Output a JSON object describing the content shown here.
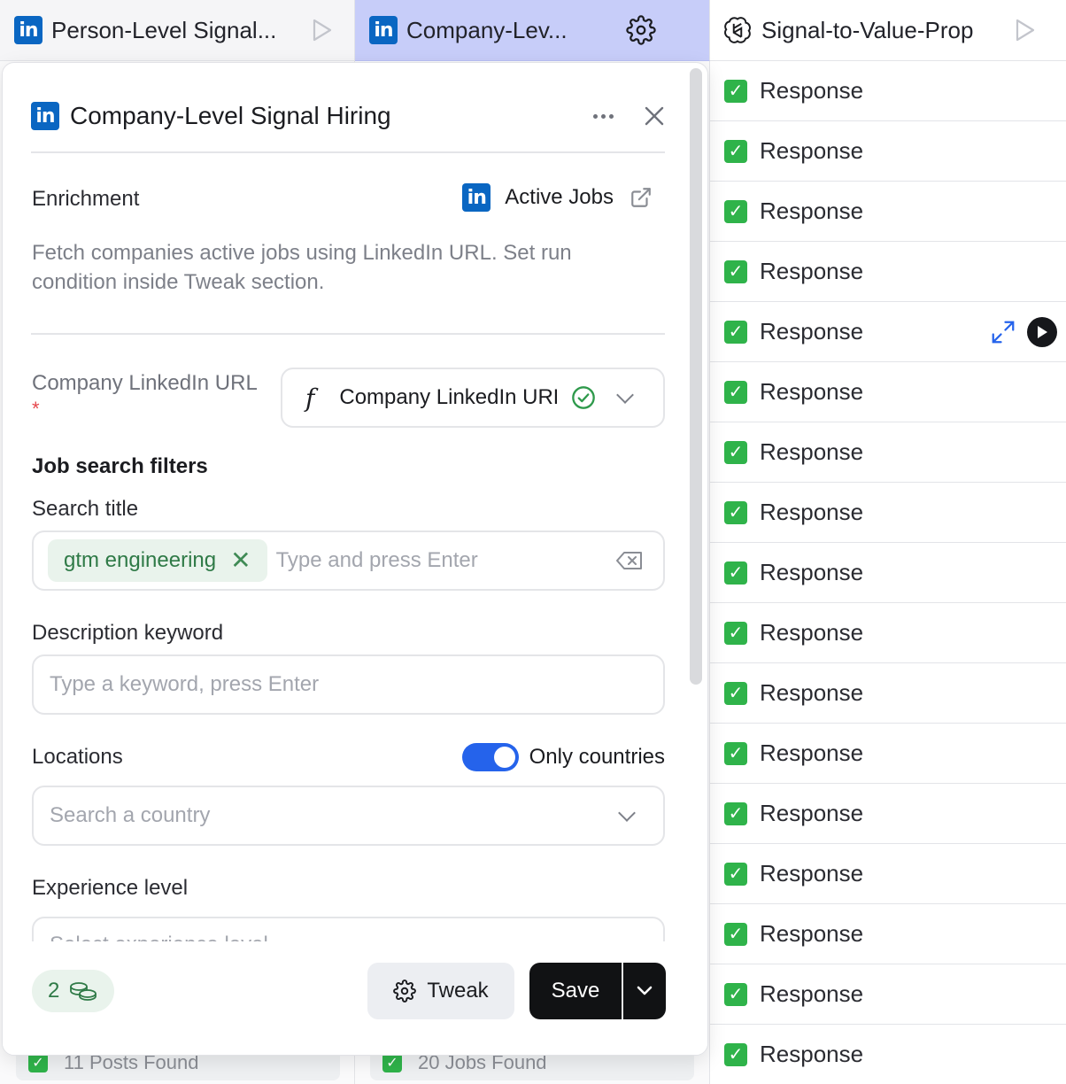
{
  "columns": [
    {
      "label": "Person-Level Signal...",
      "icon": "linkedin-icon"
    },
    {
      "label": "Company-Lev...",
      "icon": "linkedin-icon"
    },
    {
      "label": "Signal-to-Value-Prop",
      "icon": "openai-icon"
    }
  ],
  "linkedin_glyph": "in",
  "panel": {
    "title": "Company-Level Signal Hiring",
    "enrichment_label": "Enrichment",
    "enrichment_source": "Active Jobs",
    "description": "Fetch companies active jobs using LinkedIn URL. Set run condition inside Tweak section.",
    "company_url": {
      "label": "Company LinkedIn URL",
      "required_mark": "*",
      "value": "Company LinkedIn URL"
    },
    "job_filters_heading": "Job search filters",
    "search_title": {
      "label": "Search title",
      "chips": [
        "gtm engineering"
      ],
      "placeholder": "Type and press Enter"
    },
    "description_keyword": {
      "label": "Description keyword",
      "placeholder": "Type a keyword, press Enter"
    },
    "locations": {
      "label": "Locations",
      "toggle_label": "Only countries",
      "toggle_on": true,
      "placeholder": "Search a country"
    },
    "experience_level": {
      "label": "Experience level",
      "placeholder": "Select experience level"
    },
    "footer": {
      "credits": "2",
      "tweak_label": "Tweak",
      "save_label": "Save"
    }
  },
  "response_rows": [
    "Response",
    "Response",
    "Response",
    "Response",
    "Response",
    "Response",
    "Response",
    "Response",
    "Response",
    "Response",
    "Response",
    "Response",
    "Response",
    "Response",
    "Response",
    "Response",
    "Response"
  ],
  "under_cells": [
    "11 Posts Found",
    "20 Jobs Found"
  ],
  "colors": {
    "linkedin": "#0a66c2",
    "selected_header": "#c7cdf9",
    "check_green": "#2fb34a",
    "toggle_blue": "#2563eb"
  }
}
